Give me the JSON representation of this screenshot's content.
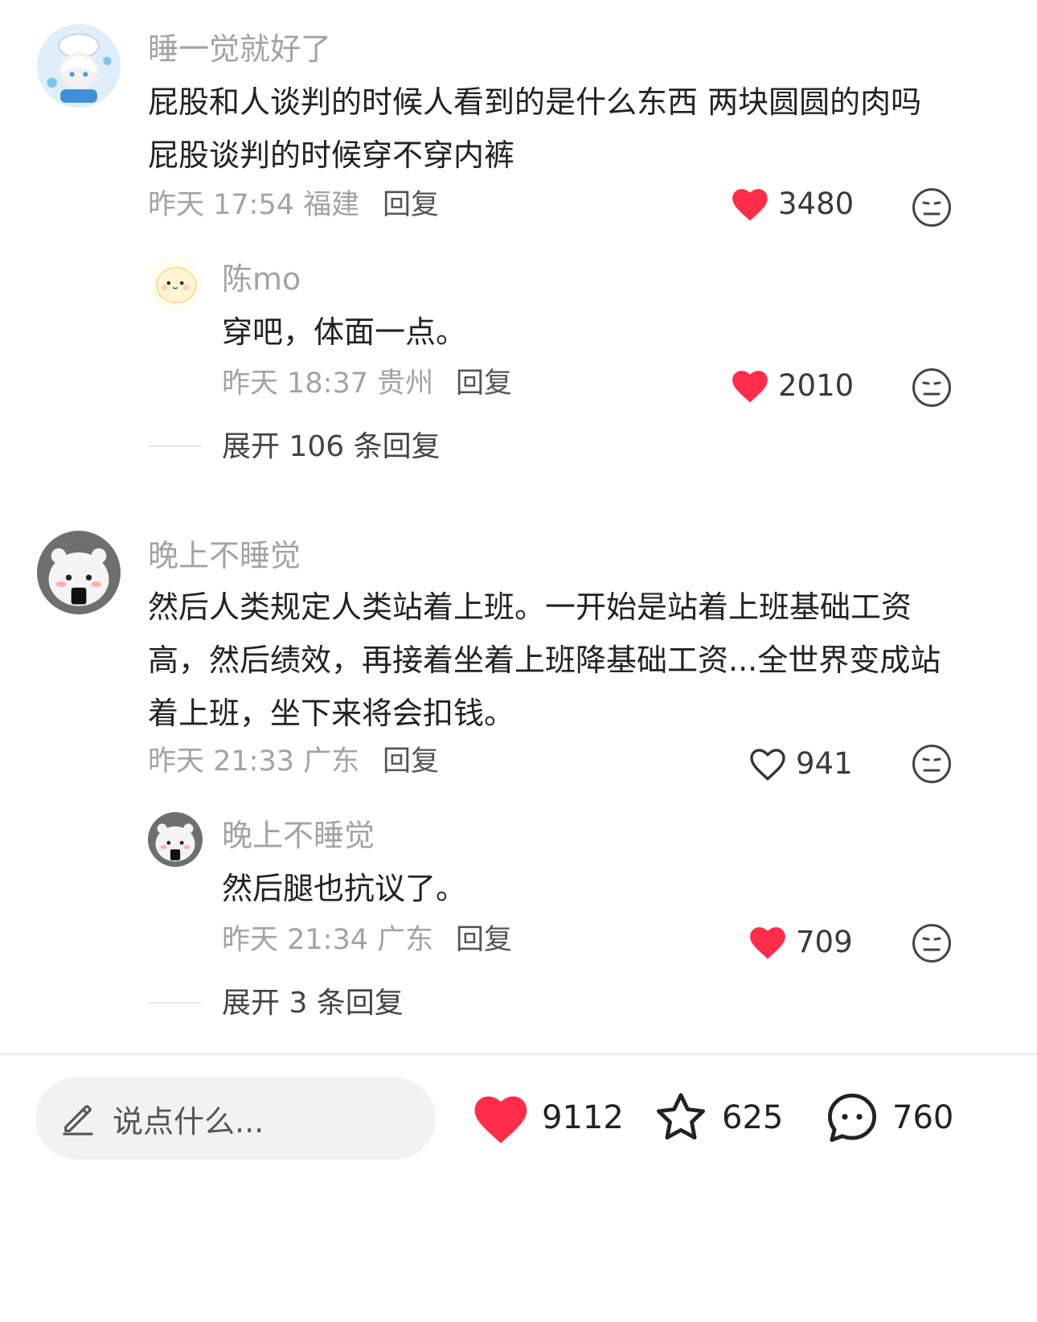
{
  "comments": [
    {
      "username": "睡一觉就好了",
      "text": "屁股和人谈判的时候人看到的是什么东西 两块圆圆的肉吗 屁股谈判的时候穿不穿内裤",
      "time": "昨天 17:54 福建",
      "reply_label": "回复",
      "likes": "3480",
      "liked": true,
      "replies": [
        {
          "username": "陈mo",
          "text": "穿吧，体面一点。",
          "time": "昨天 18:37 贵州",
          "reply_label": "回复",
          "likes": "2010",
          "liked": true
        }
      ],
      "expand_label": "展开 106 条回复"
    },
    {
      "username": "晚上不睡觉",
      "text": "然后人类规定人类站着上班。一开始是站着上班基础工资高，然后绩效，再接着坐着上班降基础工资...全世界变成站着上班，坐下来将会扣钱。",
      "time": "昨天 21:33 广东",
      "reply_label": "回复",
      "likes": "941",
      "liked": false,
      "replies": [
        {
          "username": "晚上不睡觉",
          "text": "然后腿也抗议了。",
          "time": "昨天 21:34 广东",
          "reply_label": "回复",
          "likes": "709",
          "liked": true
        }
      ],
      "expand_label": "展开 3 条回复"
    }
  ],
  "bottom_bar": {
    "input_placeholder": "说点什么...",
    "likes": "9112",
    "favorites": "625",
    "comments": "760"
  },
  "colors": {
    "liked_heart": "#ff2d4a",
    "meta_gray": "#a3a3a3",
    "text": "#222222"
  },
  "icons": [
    "heart-icon",
    "heart-outline-icon",
    "meh-face-icon",
    "pencil-icon",
    "star-icon",
    "chat-bubble-icon"
  ]
}
